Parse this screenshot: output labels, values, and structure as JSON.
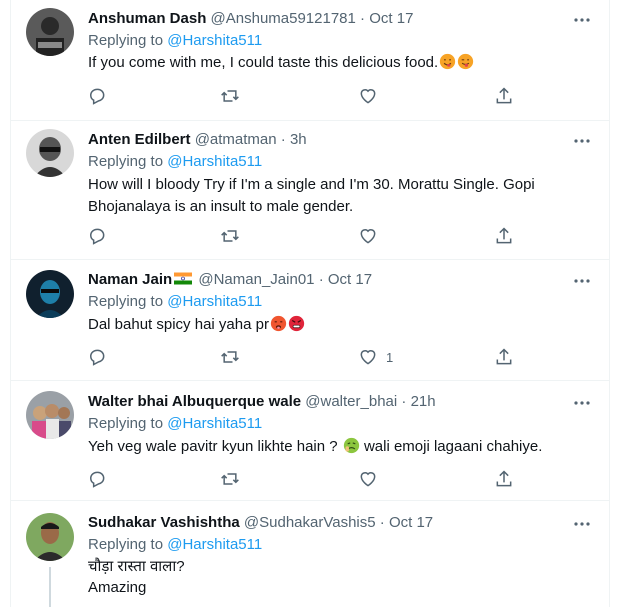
{
  "tweets": [
    {
      "name": "Anshuman Dash",
      "handle": "@Anshuma59121781",
      "sep": "·",
      "time": "Oct 17",
      "replying_label": "Replying to",
      "mention": "@Harshita511",
      "text": "If you come with me, I could taste this delicious food.",
      "emojis": [
        "face-savoring-food",
        "winking-tongue-face"
      ]
    },
    {
      "name": "Anten Edilbert",
      "handle": "@atmatman",
      "sep": "·",
      "time": "3h",
      "replying_label": "Replying to",
      "mention": "@Harshita511",
      "text": "How will I bloody Try if I'm a single and I'm 30. Morattu Single. Gopi Bhojanalaya is an insult to male gender."
    },
    {
      "name": "Naman Jain",
      "handle": "@Naman_Jain01",
      "sep": "·",
      "time": "Oct 17",
      "replying_label": "Replying to",
      "mention": "@Harshita511",
      "text": "Dal bahut spicy hai yaha pr",
      "like_count": "1",
      "emojis": [
        "hot-face",
        "angry-face"
      ]
    },
    {
      "name": "Walter bhai Albuquerque wale",
      "handle": "@walter_bhai",
      "sep": "·",
      "time": "21h",
      "replying_label": "Replying to",
      "mention": "@Harshita511",
      "text_before": "Yeh veg wale pavitr kyun likhte hain ?",
      "text_after": "wali emoji lagaani chahiye.",
      "emojis": [
        "nauseated-face"
      ]
    },
    {
      "name": "Sudhakar Vashishtha",
      "handle": "@SudhakarVashis5",
      "sep": "·",
      "time": "Oct 17",
      "replying_label": "Replying to",
      "mention": "@Harshita511",
      "line1": "चौड़ा रास्ता वाला?",
      "line2": "Amazing"
    }
  ],
  "icons": [
    "more-icon",
    "reply-icon",
    "retweet-icon",
    "like-icon",
    "share-icon"
  ],
  "colors": {
    "accent": "#1d9bf0",
    "secondary": "#536471",
    "divider": "#eff3f4"
  }
}
